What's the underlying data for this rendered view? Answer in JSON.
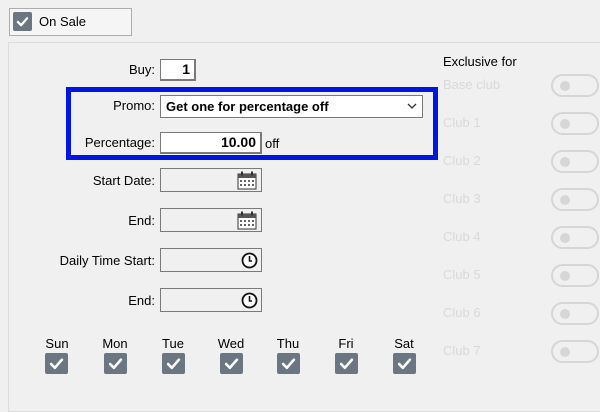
{
  "header": {
    "on_sale_label": "On Sale",
    "on_sale_checked": true
  },
  "form": {
    "buy_label": "Buy:",
    "buy_value": "1",
    "promo_label": "Promo:",
    "promo_value": "Get one for percentage off",
    "percentage_label": "Percentage:",
    "percentage_value": "10.00",
    "percentage_suffix": "off",
    "start_date_label": "Start Date:",
    "start_date_value": "",
    "end_date_label": "End:",
    "end_date_value": "",
    "daily_time_start_label": "Daily Time Start:",
    "daily_time_start_value": "",
    "daily_time_end_label": "End:",
    "daily_time_end_value": ""
  },
  "days": [
    {
      "label": "Sun",
      "checked": true
    },
    {
      "label": "Mon",
      "checked": true
    },
    {
      "label": "Tue",
      "checked": true
    },
    {
      "label": "Wed",
      "checked": true
    },
    {
      "label": "Thu",
      "checked": true
    },
    {
      "label": "Fri",
      "checked": true
    },
    {
      "label": "Sat",
      "checked": true
    }
  ],
  "exclusive": {
    "title": "Exclusive for",
    "clubs": [
      {
        "label": "Base club",
        "enabled": false
      },
      {
        "label": "Club 1",
        "enabled": false
      },
      {
        "label": "Club 2",
        "enabled": false
      },
      {
        "label": "Club 3",
        "enabled": false
      },
      {
        "label": "Club 4",
        "enabled": false
      },
      {
        "label": "Club 5",
        "enabled": false
      },
      {
        "label": "Club 6",
        "enabled": false
      },
      {
        "label": "Club 7",
        "enabled": false
      }
    ]
  },
  "colors": {
    "highlight_border": "#0015e0",
    "checkbox_fill": "#6b7683",
    "disabled_text": "#d9d9d9"
  },
  "icons": {
    "checkbox": "checkmark-icon",
    "dropdown": "chevron-down-icon",
    "date": "calendar-icon",
    "time": "clock-icon"
  }
}
